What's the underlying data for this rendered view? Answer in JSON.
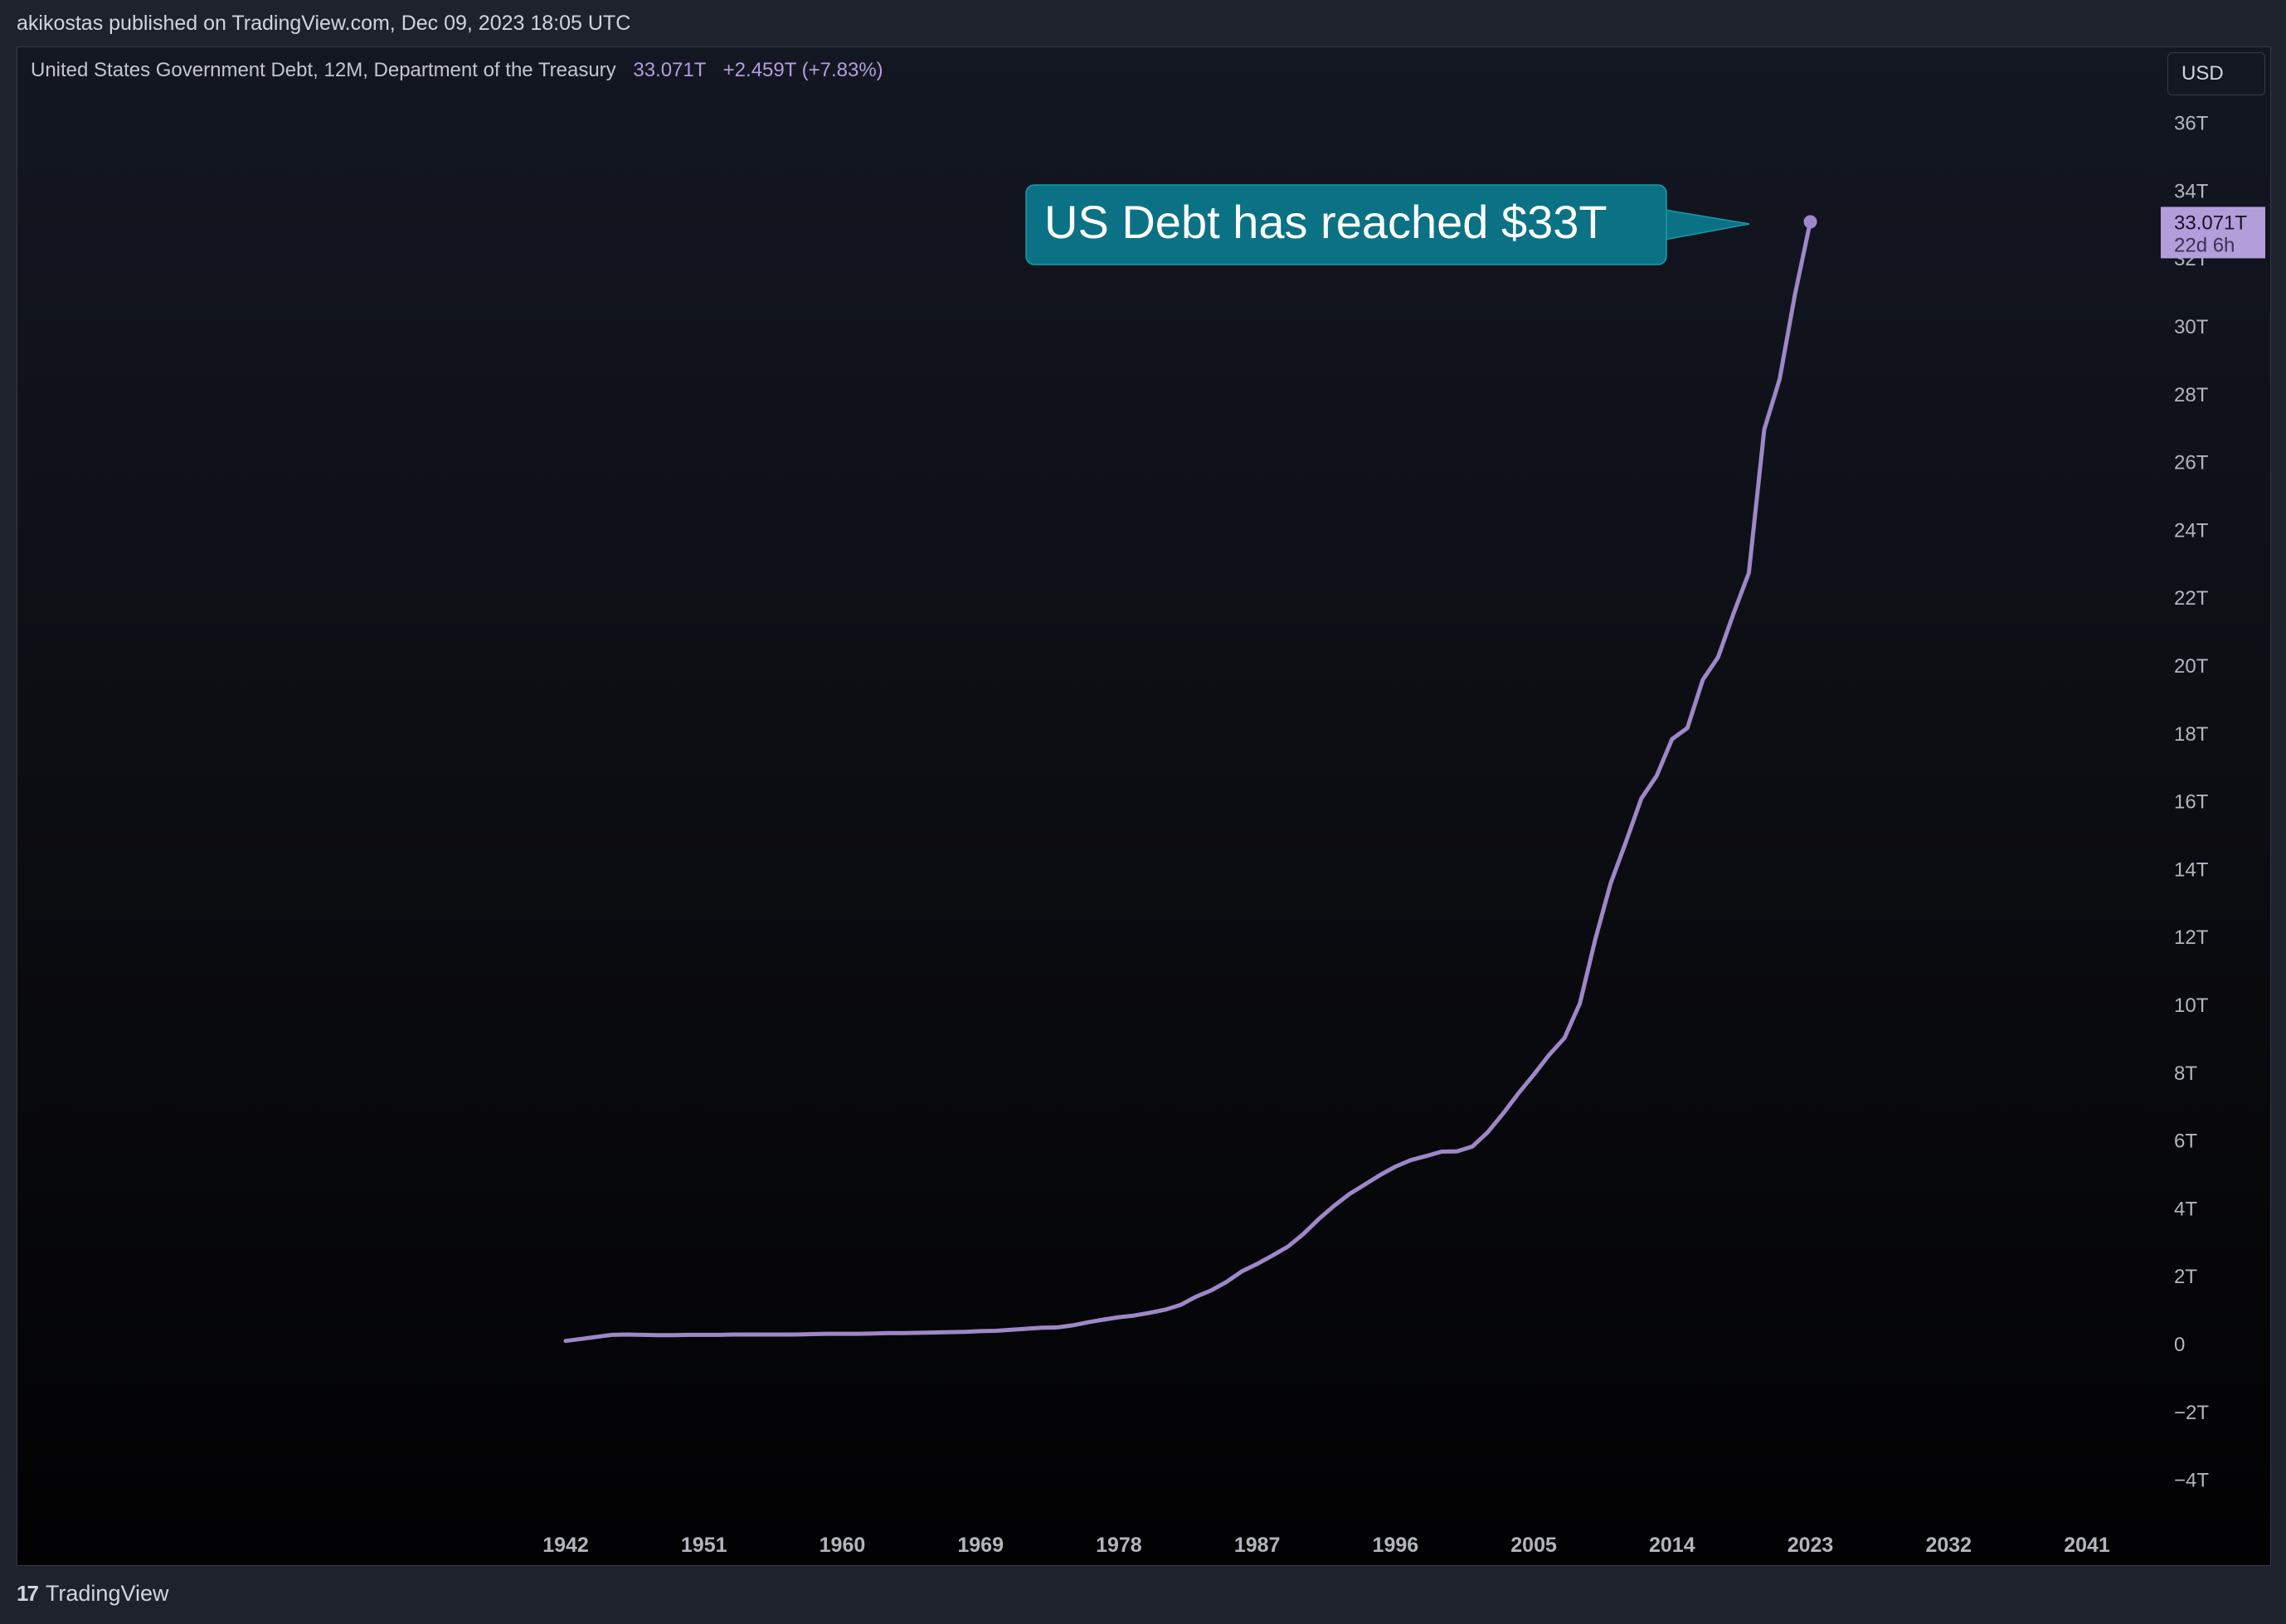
{
  "header": {
    "published": "akikostas published on TradingView.com, Dec 09, 2023 18:05 UTC"
  },
  "legend": {
    "title": "United States Government Debt, 12M, Department of the Treasury",
    "value": "33.071T",
    "change": "+2.459T (+7.83%)"
  },
  "currency_button": "USD",
  "annotation": {
    "text": "US Debt has reached $33T",
    "color": "#0b7285"
  },
  "price_label": {
    "value": "33.071T",
    "countdown": "22d 6h",
    "color": "#b39ddb"
  },
  "footer": {
    "logo": "17",
    "brand": "TradingView"
  },
  "colors": {
    "line": "#9e87c9",
    "axis_text": "#b2b5be"
  },
  "chart_data": {
    "type": "line",
    "title": "United States Government Debt, 12M, Department of the Treasury",
    "xlim": [
      1938,
      2043
    ],
    "ylim": [
      -5,
      37
    ],
    "yunit": "T",
    "x_ticks": [
      "1942",
      "1951",
      "1960",
      "1969",
      "1978",
      "1987",
      "1996",
      "2005",
      "2014",
      "2023",
      "2032",
      "2041"
    ],
    "y_ticks": [
      "36T",
      "34T",
      "32T",
      "30T",
      "28T",
      "26T",
      "24T",
      "22T",
      "20T",
      "18T",
      "16T",
      "14T",
      "12T",
      "10T",
      "8T",
      "6T",
      "4T",
      "2T",
      "0",
      "−2T",
      "−4T"
    ],
    "y_tick_values": [
      36,
      34,
      32,
      30,
      28,
      26,
      24,
      22,
      20,
      18,
      16,
      14,
      12,
      10,
      8,
      6,
      4,
      2,
      0,
      -2,
      -4
    ],
    "series": [
      {
        "x": [
          1942,
          1943,
          1944,
          1945,
          1946,
          1947,
          1948,
          1949,
          1950,
          1951,
          1952,
          1953,
          1954,
          1955,
          1956,
          1957,
          1958,
          1959,
          1960,
          1961,
          1962,
          1963,
          1964,
          1965,
          1966,
          1967,
          1968,
          1969,
          1970,
          1971,
          1972,
          1973,
          1974,
          1975,
          1976,
          1977,
          1978,
          1979,
          1980,
          1981,
          1982,
          1983,
          1984,
          1985,
          1986,
          1987,
          1988,
          1989,
          1990,
          1991,
          1992,
          1993,
          1994,
          1995,
          1996,
          1997,
          1998,
          1999,
          2000,
          2001,
          2002,
          2003,
          2004,
          2005,
          2006,
          2007,
          2008,
          2009,
          2010,
          2011,
          2012,
          2013,
          2014,
          2015,
          2016,
          2017,
          2018,
          2019,
          2020,
          2021,
          2022,
          2023
        ],
        "values": [
          0.08,
          0.14,
          0.2,
          0.26,
          0.27,
          0.26,
          0.25,
          0.25,
          0.26,
          0.26,
          0.26,
          0.27,
          0.27,
          0.27,
          0.27,
          0.27,
          0.28,
          0.29,
          0.29,
          0.29,
          0.3,
          0.31,
          0.31,
          0.32,
          0.33,
          0.34,
          0.35,
          0.37,
          0.38,
          0.41,
          0.44,
          0.47,
          0.48,
          0.54,
          0.63,
          0.71,
          0.78,
          0.83,
          0.91,
          1.0,
          1.14,
          1.38,
          1.57,
          1.82,
          2.13,
          2.35,
          2.6,
          2.86,
          3.23,
          3.67,
          4.06,
          4.41,
          4.69,
          4.97,
          5.22,
          5.41,
          5.53,
          5.66,
          5.67,
          5.81,
          6.23,
          6.78,
          7.38,
          7.93,
          8.51,
          9.01,
          10.03,
          11.91,
          13.56,
          14.79,
          16.07,
          16.74,
          17.82,
          18.15,
          19.57,
          20.24,
          21.52,
          22.72,
          26.95,
          28.43,
          30.93,
          33.07
        ]
      }
    ]
  }
}
